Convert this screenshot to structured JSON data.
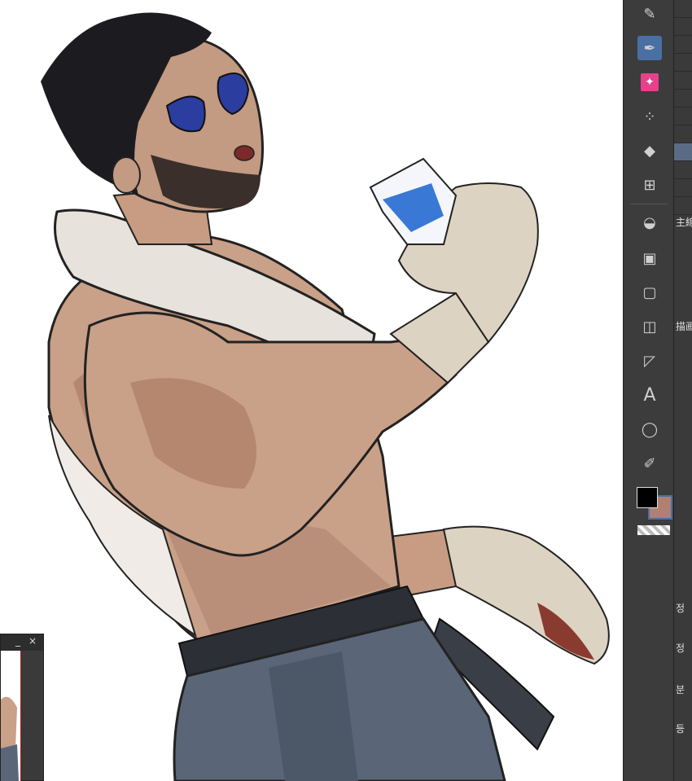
{
  "navigator": {
    "minimize": "_",
    "close": "×"
  },
  "toolbar": {
    "tools": [
      {
        "name": "pen-icon",
        "glyph": "✎"
      },
      {
        "name": "brush-icon",
        "glyph": "✒"
      },
      {
        "name": "sparkle-icon",
        "glyph": "✦"
      },
      {
        "name": "airbrush-icon",
        "glyph": "⁘"
      },
      {
        "name": "eraser-icon",
        "glyph": "◆"
      },
      {
        "name": "grid-icon",
        "glyph": "⊞"
      },
      {
        "name": "fill-icon",
        "glyph": "◒"
      },
      {
        "name": "gradient-icon",
        "glyph": "▣"
      },
      {
        "name": "rectangle-icon",
        "glyph": "▢"
      },
      {
        "name": "frame-icon",
        "glyph": "◫"
      },
      {
        "name": "ruler-icon",
        "glyph": "◸"
      },
      {
        "name": "text-icon",
        "glyph": "A"
      },
      {
        "name": "balloon-icon",
        "glyph": "◯"
      },
      {
        "name": "correction-icon",
        "glyph": "✐"
      }
    ],
    "main_color": "#000000",
    "sub_color": "#b08070"
  },
  "sub_panel": {
    "label_main": "主線",
    "label_draw": "描画",
    "label_jeong": "정",
    "label_jeong2": "정",
    "label_bun": "분",
    "label_deung": "등"
  }
}
